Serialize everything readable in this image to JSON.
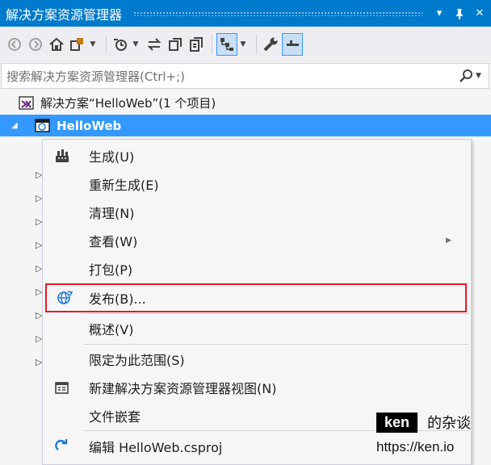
{
  "window": {
    "title": "解决方案资源管理器",
    "buttons": [
      "▾",
      "⊥",
      "✕"
    ]
  },
  "toolbar": {
    "icons": [
      "back-icon",
      "forward-icon",
      "home-icon",
      "switch-views-icon",
      "history-icon",
      "sync-icon",
      "collapse-all-icon",
      "show-all-files-icon",
      "tree-view-icon",
      "properties-icon",
      "preview-selected-icon"
    ]
  },
  "search": {
    "placeholder": "搜索解决方案资源管理器(Ctrl+;)"
  },
  "tree": {
    "solution_label": "解决方案“HelloWeb”(1 个项目)",
    "project_label": "HelloWeb"
  },
  "context_menu": {
    "items": [
      {
        "label": "生成(U)",
        "icon": "build-icon"
      },
      {
        "label": "重新生成(E)",
        "icon": ""
      },
      {
        "label": "清理(N)",
        "icon": ""
      },
      {
        "label": "查看(W)",
        "icon": "",
        "submenu": true
      },
      {
        "label": "打包(P)",
        "icon": ""
      },
      {
        "label": "发布(B)...",
        "icon": "publish-globe-icon",
        "highlighted": true
      },
      {
        "label": "概述(V)",
        "icon": ""
      },
      {
        "label": "限定为此范围(S)",
        "icon": ""
      },
      {
        "label": "新建解决方案资源管理器视图(N)",
        "icon": "new-view-icon"
      },
      {
        "label": "文件嵌套",
        "icon": ""
      },
      {
        "label": "编辑 HelloWeb.csproj",
        "icon": "edit-arrow-icon"
      }
    ]
  },
  "watermark": {
    "badge": "ken",
    "suffix": "的杂谈",
    "url": "https://ken.io"
  },
  "colors": {
    "accent": "#007acc",
    "selection": "#3399ff",
    "highlight_border": "#e51b24"
  }
}
